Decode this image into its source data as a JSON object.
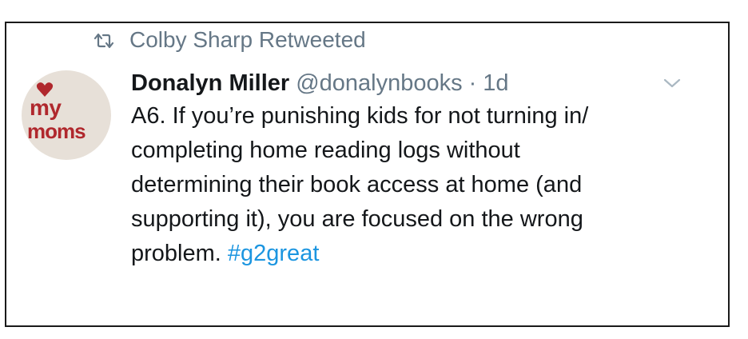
{
  "retweet": {
    "icon": "retweet-icon",
    "label": "Colby Sharp Retweeted"
  },
  "avatar": {
    "line1": "my",
    "line2": "moms",
    "heart_icon": "heart-icon",
    "accent_color": "#b0282d"
  },
  "tweet": {
    "display_name": "Donalyn Miller",
    "handle": "@donalynbooks",
    "separator": "·",
    "time": "1d",
    "menu_icon": "chevron-down-icon",
    "lines": [
      "A6. If you’re punishing kids for not turning in/",
      "completing home reading logs without",
      "determining their book access at home (and",
      "supporting it), you are focused on the wrong"
    ],
    "last_line_prefix": "problem. ",
    "hashtag": "#g2great"
  },
  "colors": {
    "text": "#14171a",
    "secondary": "#657786",
    "link": "#1b95e0",
    "border": "#1a1a1a"
  }
}
